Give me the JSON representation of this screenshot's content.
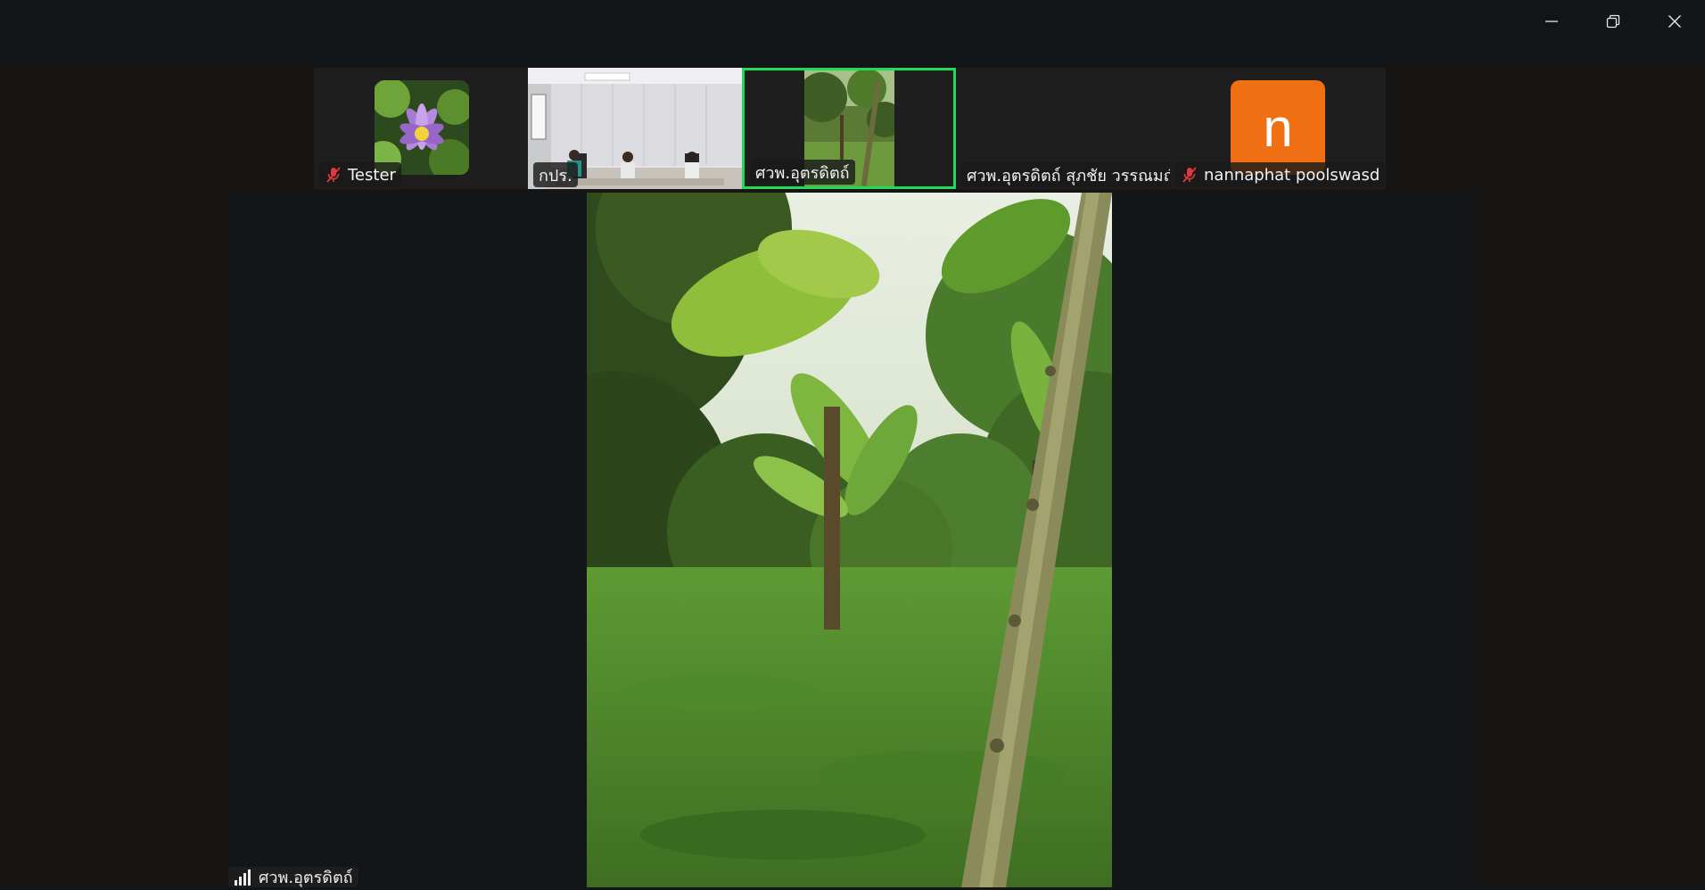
{
  "window": {
    "controls": {
      "minimize": "minimize-icon",
      "restore": "restore-icon",
      "close": "close-icon"
    }
  },
  "participants": [
    {
      "name": "Tester",
      "muted": true,
      "avatar": "lotus-flower-photo"
    },
    {
      "name": "กปร.",
      "muted": false,
      "avatar": "meeting-room-video"
    },
    {
      "name": "ศวพ.อุตรดิตถ์",
      "muted": false,
      "avatar": "garden-video",
      "active": true
    },
    {
      "name": "ศวพ.อุตรดิตถ์ สุภชัย วรรณมณี",
      "muted": false,
      "avatar": "none"
    },
    {
      "name": "nannaphat poolswasd",
      "muted": true,
      "avatar_letter": "n",
      "avatar_color": "#f06f12"
    }
  ],
  "main_speaker": {
    "name": "ศวพ.อุตรดิตถ์",
    "signal_icon": "signal-strength-icon"
  },
  "colors": {
    "active_border": "#23d959",
    "muted_mic": "#e0393e",
    "background": "#131619"
  }
}
